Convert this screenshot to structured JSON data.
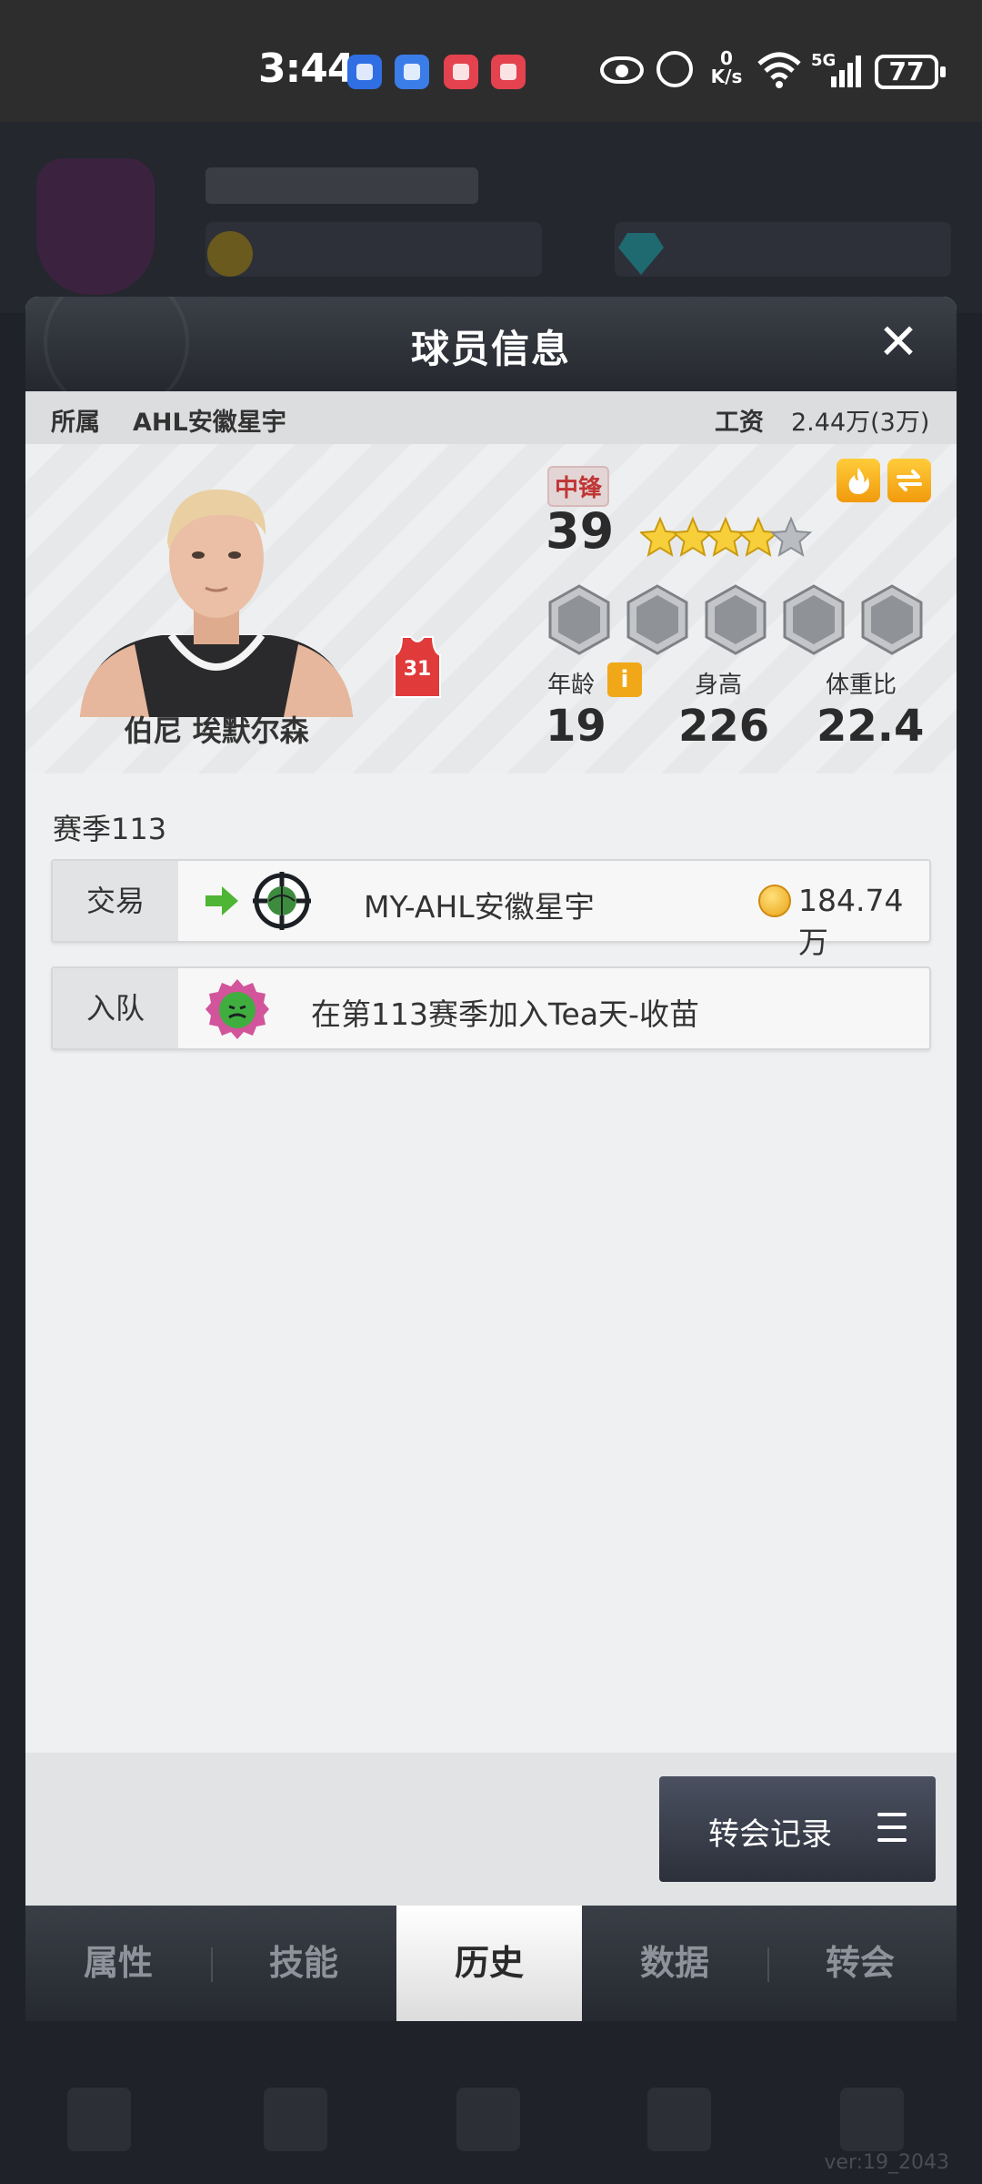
{
  "status_bar": {
    "time": "3:44",
    "net_speed_value": "0",
    "net_speed_unit": "K/s",
    "network": "5G",
    "battery": "77"
  },
  "background": {
    "version": "ver:19_2043"
  },
  "modal": {
    "title": "球员信息",
    "close_icon": "close-icon"
  },
  "player": {
    "team_label": "所属",
    "team": "AHL安徽星宇",
    "salary_label": "工资",
    "salary": "2.44万(3万)",
    "position": "中锋",
    "rating": "39",
    "stars": 4,
    "stars_total": 5,
    "name": "伯尼 埃默尔森",
    "jersey_number": "31",
    "age_label": "年龄",
    "age": "19",
    "height_label": "身高",
    "height": "226",
    "weight_ratio_label": "体重比",
    "weight_ratio": "22.4"
  },
  "history": {
    "season_label": "赛季113",
    "records": [
      {
        "type": "交易",
        "team": "MY-AHL安徽星宇",
        "price": "184.74万"
      },
      {
        "type": "入队",
        "text": "在第113赛季加入Tea天-收苗"
      }
    ]
  },
  "buttons": {
    "transfer_record": "转会记录"
  },
  "tabs": [
    {
      "label": "属性",
      "active": false
    },
    {
      "label": "技能",
      "active": false
    },
    {
      "label": "历史",
      "active": true
    },
    {
      "label": "数据",
      "active": false
    },
    {
      "label": "转会",
      "active": false
    }
  ],
  "colors": {
    "position_badge": "#c03535",
    "accent_gold": "#f0a818",
    "trade_arrow": "#4fb534"
  }
}
